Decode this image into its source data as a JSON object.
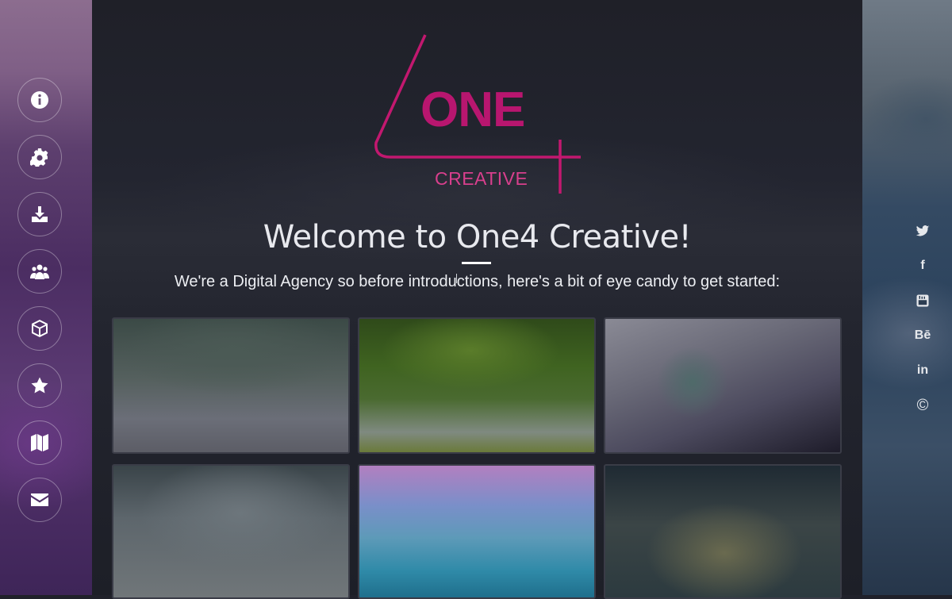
{
  "brand": {
    "logo_word": "ONE",
    "logo_sub": "CREATIVE",
    "logo_accent": "#c2186f"
  },
  "hero": {
    "title": "Welcome to One4 Creative!",
    "subtitle": "We're a Digital Agency so before introductions, here's a bit of eye candy to get started:"
  },
  "side_nav": {
    "items": [
      {
        "icon": "info-icon"
      },
      {
        "icon": "gear-icon"
      },
      {
        "icon": "download-icon"
      },
      {
        "icon": "users-icon"
      },
      {
        "icon": "cube-icon"
      },
      {
        "icon": "star-icon"
      },
      {
        "icon": "map-icon"
      },
      {
        "icon": "envelope-icon"
      }
    ]
  },
  "social": {
    "items": [
      {
        "icon": "twitter-icon"
      },
      {
        "icon": "facebook-icon",
        "text": "f"
      },
      {
        "icon": "youtube-icon"
      },
      {
        "icon": "behance-icon",
        "text": "Bē"
      },
      {
        "icon": "linkedin-icon",
        "text": "in"
      },
      {
        "icon": "copyright-icon",
        "text": "©"
      }
    ]
  },
  "gallery": {
    "tiles": 6
  }
}
